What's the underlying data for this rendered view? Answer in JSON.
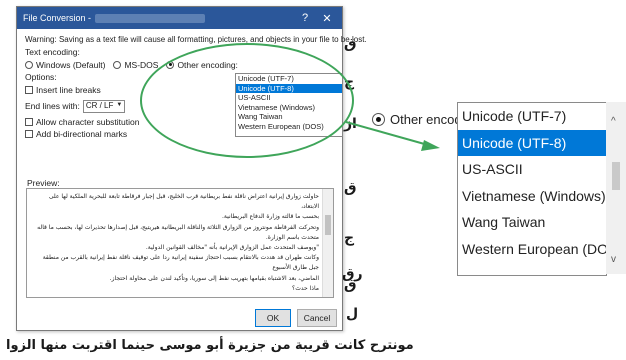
{
  "dialog": {
    "title": "File Conversion -",
    "help": "?",
    "close": "✕",
    "warning": "Warning: Saving as a text file will cause all formatting, pictures, and objects in your file to be lost.",
    "text_encoding_label": "Text encoding:",
    "radio_windows": "Windows (Default)",
    "radio_msdos": "MS-DOS",
    "radio_other": "Other encoding:",
    "options_label": "Options:",
    "insert_line_breaks": "Insert line breaks",
    "end_lines_label": "End lines with:",
    "end_lines_value": "CR / LF",
    "allow_char_sub": "Allow character substitution",
    "add_bidi": "Add bi-directional marks",
    "preview_label": "Preview:",
    "ok": "OK",
    "cancel": "Cancel"
  },
  "encodings": [
    "Unicode (UTF-7)",
    "Unicode (UTF-8)",
    "US-ASCII",
    "Vietnamese (Windows)",
    "Wang Taiwan",
    "Western European (DOS)"
  ],
  "selected_encoding": "Unicode (UTF-8)",
  "zoom": {
    "radio_other": "Other encoding:"
  },
  "preview_lines": [
    "حاولت زوارق إيرانية اعتراض ناقلة نفط بريطانية قرب الخليج، قبل إجبار فرقاطة تابعة للبحرية الملكية لها على الابتعاد،",
    "بحسب ما قالته وزارة الدفاع البريطانية.",
    "وتحركت الفرقاطة مونتروز من الزوارق الثلاثة والناقلة البريطانية هيريتيج، قبل إصدارها تحذيرات لها، بحسب ما قاله",
    "متحدث باسم الوزارة.",
    "\"ويوصف المتحدث عمل الزوارق الإيرانية بأنه \"مخالف القوانين الدولية.",
    "وكانت طهران قد هددت بالانتقام بسبب احتجاز سفينة إيرانية ردا على توقيف ناقلة نفط إيرانية بالقرب من منطقة جبل طارق الأسبوع",
    "الماضي، بعد الاشتباه بقيامها بتهريب نفط إلى سوريا، وتأكيد لندن على محاولة احتجاز.",
    "ماذا حدث؟"
  ],
  "background_text": {
    "line_1": "ق",
    "line_2": "ج",
    "line_3": "از",
    "line_4": "ق",
    "line_5": "ج",
    "line_6": "رق",
    "line_7": "ق",
    "line_8": "ل",
    "bottom": "مونترح كانت قريبة من جزيرة أبو موسى حينما اقتربت منها الزوا"
  }
}
